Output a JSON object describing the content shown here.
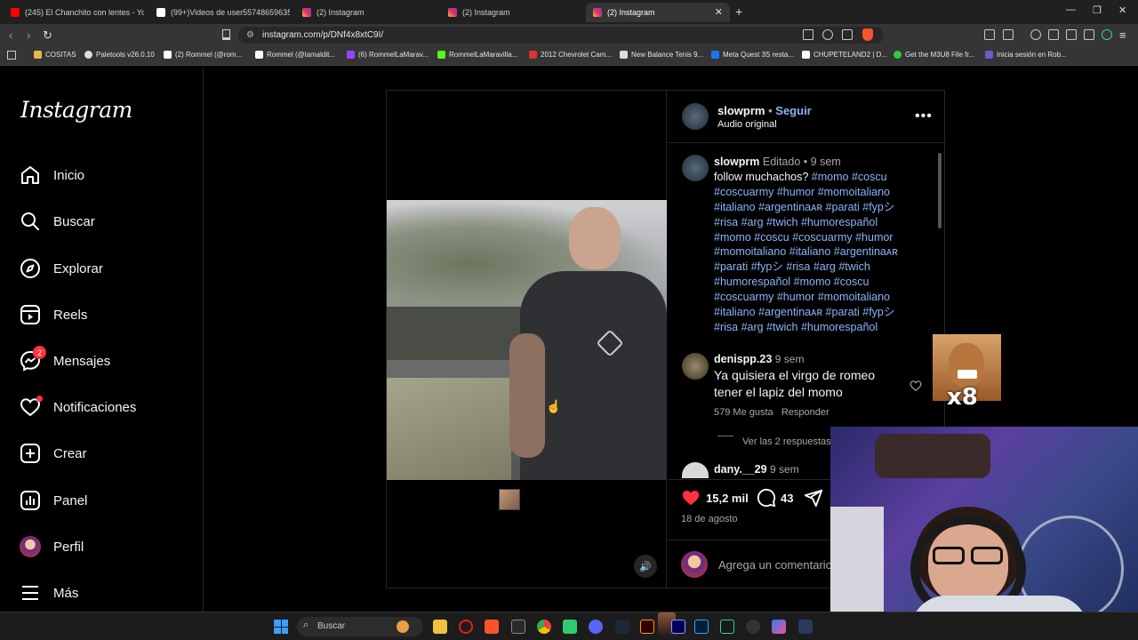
{
  "browser": {
    "tabs": [
      {
        "label": "(245) El Chanchito con lentes - YouTube",
        "color": "#ff0000"
      },
      {
        "label": "(99+)Videos de user55748659635 (@",
        "color": "#ffffff"
      },
      {
        "label": "(2) Instagram",
        "color": "#e1306c"
      },
      {
        "label": "(2) Instagram",
        "color": "#e1306c"
      },
      {
        "label": "(2) Instagram",
        "color": "#e1306c"
      }
    ],
    "new_tab": "+",
    "url": "instagram.com/p/DNf4x8xtC9I/",
    "bookmarks": [
      {
        "label": "COSITAS",
        "color": "#e8b84a"
      },
      {
        "label": "Paletools v26.0.10",
        "color": "#dddddd"
      },
      {
        "label": "(2) Rommel (@rom...",
        "color": "#ffffff"
      },
      {
        "label": "Rommel (@lamaldit...",
        "color": "#ffffff"
      },
      {
        "label": "(6) RommelLaMarav...",
        "color": "#9146ff"
      },
      {
        "label": "RommelLaMaravilla...",
        "color": "#53fc18"
      },
      {
        "label": "2012 Chevrolet Cam...",
        "color": "#e03030"
      },
      {
        "label": "New Balance Tenis 9...",
        "color": "#dddddd"
      },
      {
        "label": "Meta Quest 3S resta...",
        "color": "#1877f2"
      },
      {
        "label": "CHUPETELAND2 | D...",
        "color": "#ffffff"
      },
      {
        "label": "Get the M3U8 File fr...",
        "color": "#2ecc40"
      },
      {
        "label": "Inicia sesión en Rob...",
        "color": "#6a5acd"
      }
    ]
  },
  "sidebar": {
    "logo": "Instagram",
    "items": [
      {
        "label": "Inicio",
        "icon": "home-icon"
      },
      {
        "label": "Buscar",
        "icon": "search-icon"
      },
      {
        "label": "Explorar",
        "icon": "compass-icon"
      },
      {
        "label": "Reels",
        "icon": "reels-icon"
      },
      {
        "label": "Mensajes",
        "icon": "messenger-icon",
        "badge": "2"
      },
      {
        "label": "Notificaciones",
        "icon": "heart-icon"
      },
      {
        "label": "Crear",
        "icon": "plus-square-icon"
      },
      {
        "label": "Panel",
        "icon": "chart-icon"
      },
      {
        "label": "Perfil",
        "icon": "avatar-icon"
      },
      {
        "label": "Más",
        "icon": "menu-icon"
      }
    ]
  },
  "post": {
    "author": "slowprm",
    "follow": "Seguir",
    "audio": "Audio original",
    "caption_user": "slowprm",
    "edited": "Editado",
    "caption_time": "9 sem",
    "caption_text": "follow muchachos?",
    "caption_lines": [
      "#momo #coscu",
      "#coscuarmy #humor #momoitaliano",
      "#italiano #argentinaᴀʀ #parati #fypシ",
      "#risa #arg #twich #humorespañol",
      "#momo #coscu #coscuarmy #humor",
      "#momoitaliano #italiano #argentinaᴀʀ",
      "#parati #fypシ #risa #arg #twich",
      "#humorespañol  #momo #coscu",
      "#coscuarmy #humor #momoitaliano",
      "#italiano #argentinaᴀʀ #parati #fypシ",
      "#risa #arg #twich #humorespañol"
    ],
    "comments": [
      {
        "user": "denispp.23",
        "time": "9 sem",
        "text_line1": "Ya quisiera el virgo de romeo",
        "text_line2": "tener el lapiz del momo",
        "likes": "579 Me gusta",
        "reply": "Responder",
        "view_replies": "Ver las 2 respuestas"
      },
      {
        "user": "dany.__29",
        "time": "9 sem"
      }
    ],
    "like_count": "15,2 mil",
    "comment_count": "43",
    "date": "18 de agosto",
    "add_comment_placeholder": "Agrega un comentario..."
  },
  "overlay": {
    "sticker_text": "x8"
  },
  "taskbar": {
    "search": "Buscar"
  }
}
